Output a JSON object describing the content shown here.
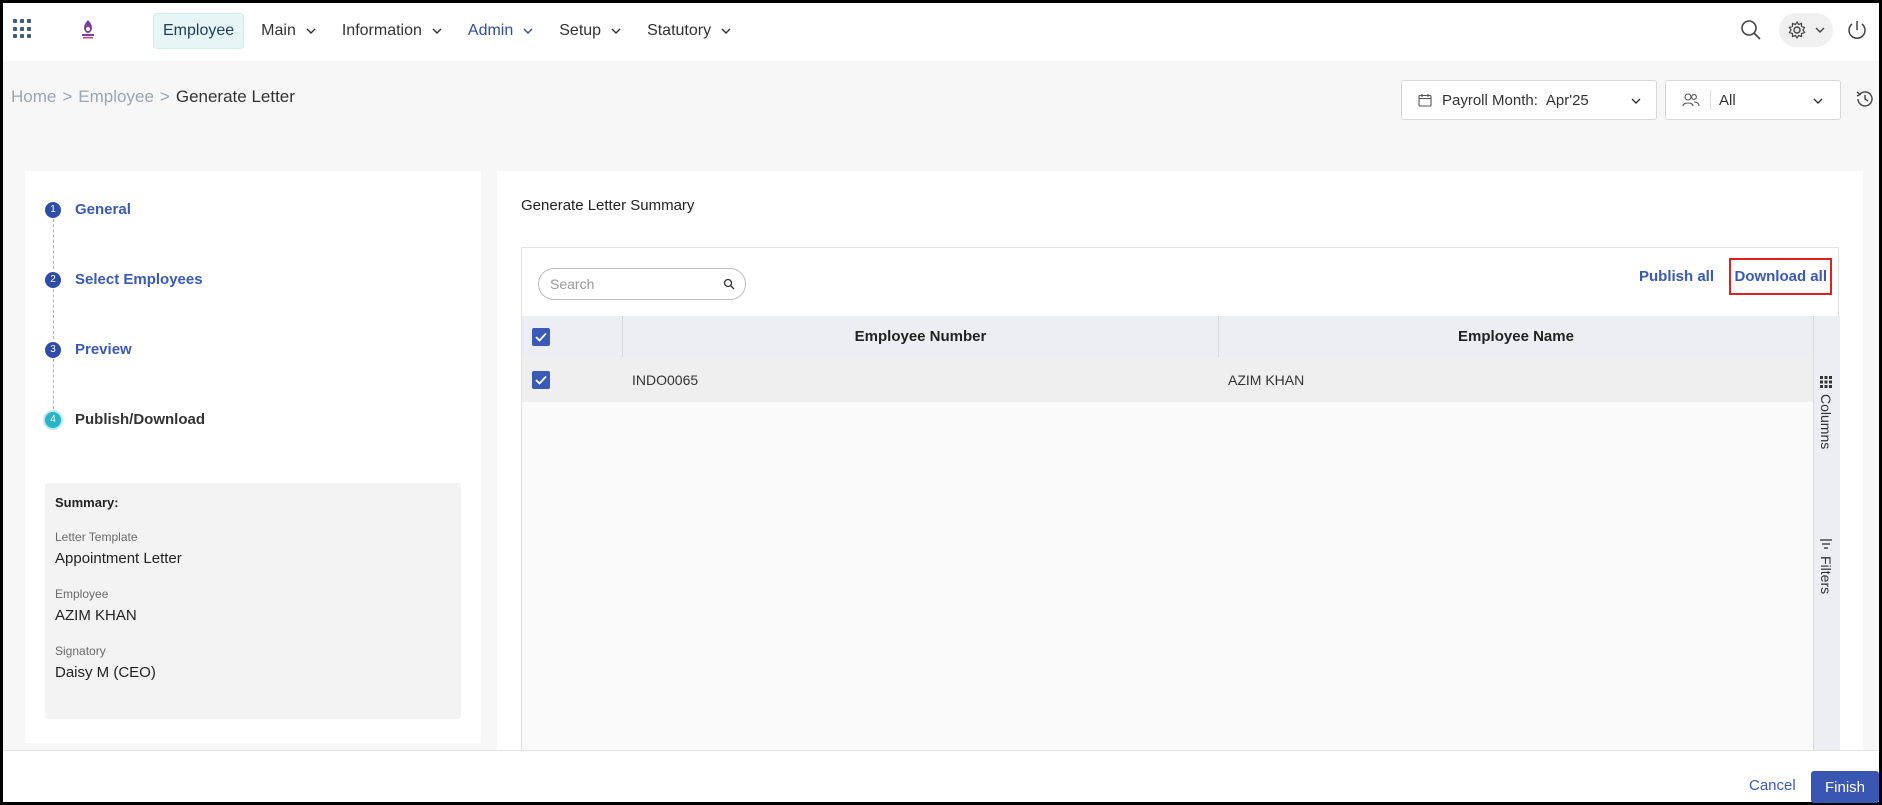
{
  "nav": {
    "items": [
      {
        "label": "Employee",
        "active": true,
        "dropdown": false
      },
      {
        "label": "Main",
        "dropdown": true
      },
      {
        "label": "Information",
        "dropdown": true
      },
      {
        "label": "Admin",
        "dropdown": true
      },
      {
        "label": "Setup",
        "dropdown": true
      },
      {
        "label": "Statutory",
        "dropdown": true
      }
    ]
  },
  "breadcrumb": {
    "home": "Home",
    "employee": "Employee",
    "current": "Generate Letter"
  },
  "filters": {
    "payroll_label": "Payroll Month:",
    "payroll_value": "Apr'25",
    "group_value": "All"
  },
  "steps": [
    {
      "num": "1",
      "label": "General"
    },
    {
      "num": "2",
      "label": "Select Employees"
    },
    {
      "num": "3",
      "label": "Preview"
    },
    {
      "num": "4",
      "label": "Publish/Download"
    }
  ],
  "summary": {
    "title": "Summary:",
    "template_label": "Letter Template",
    "template_value": "Appointment Letter",
    "employee_label": "Employee",
    "employee_value": "AZIM KHAN",
    "signatory_label": "Signatory",
    "signatory_value": "Daisy M (CEO)"
  },
  "main": {
    "title": "Generate Letter Summary",
    "search_placeholder": "Search",
    "publish_all": "Publish all",
    "download_all": "Download all",
    "columns": [
      "Employee Number",
      "Employee Name"
    ],
    "rows": [
      {
        "number": "INDO0065",
        "name": "AZIM KHAN",
        "checked": true
      }
    ],
    "side_columns": "Columns",
    "side_filters": "Filters"
  },
  "footer": {
    "cancel": "Cancel",
    "finish": "Finish"
  },
  "colors": {
    "accent": "#3a5ab8",
    "current_step": "#26b4c6",
    "highlight_border": "#dd2222"
  }
}
